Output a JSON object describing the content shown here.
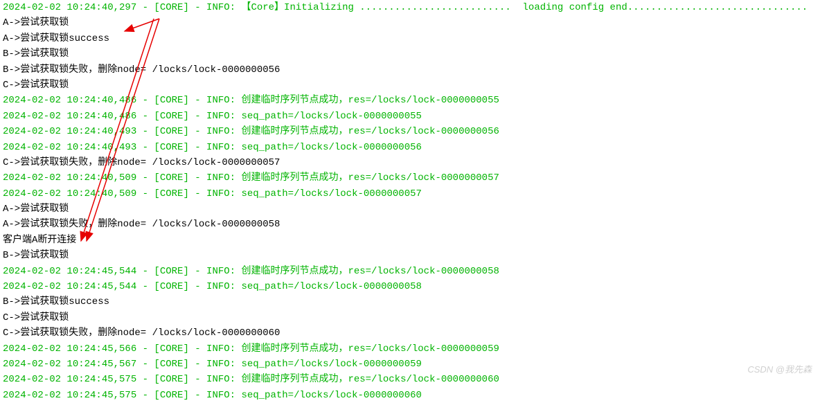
{
  "lines": [
    {
      "cls": "green",
      "text": "2024-02-02 10:24:40,297 - [CORE] - INFO: 【Core】Initializing ..........................  loading config end..............................."
    },
    {
      "cls": "black",
      "text": "A->尝试获取锁"
    },
    {
      "cls": "black",
      "text": "A->尝试获取锁success"
    },
    {
      "cls": "black",
      "text": "B->尝试获取锁"
    },
    {
      "cls": "black",
      "text": "B->尝试获取锁失败，删除node= /locks/lock-0000000056"
    },
    {
      "cls": "black",
      "text": "C->尝试获取锁"
    },
    {
      "cls": "green",
      "text": "2024-02-02 10:24:40,486 - [CORE] - INFO: 创建临时序列节点成功，res=/locks/lock-0000000055"
    },
    {
      "cls": "green",
      "text": "2024-02-02 10:24:40,486 - [CORE] - INFO: seq_path=/locks/lock-0000000055"
    },
    {
      "cls": "green",
      "text": "2024-02-02 10:24:40,493 - [CORE] - INFO: 创建临时序列节点成功，res=/locks/lock-0000000056"
    },
    {
      "cls": "green",
      "text": "2024-02-02 10:24:40,493 - [CORE] - INFO: seq_path=/locks/lock-0000000056"
    },
    {
      "cls": "black",
      "text": "C->尝试获取锁失败，删除node= /locks/lock-0000000057"
    },
    {
      "cls": "green",
      "text": "2024-02-02 10:24:40,509 - [CORE] - INFO: 创建临时序列节点成功，res=/locks/lock-0000000057"
    },
    {
      "cls": "green",
      "text": "2024-02-02 10:24:40,509 - [CORE] - INFO: seq_path=/locks/lock-0000000057"
    },
    {
      "cls": "black",
      "text": "A->尝试获取锁"
    },
    {
      "cls": "black",
      "text": "A->尝试获取锁失败，删除node= /locks/lock-0000000058"
    },
    {
      "cls": "black",
      "text": "客户端A断开连接"
    },
    {
      "cls": "black",
      "text": "B->尝试获取锁"
    },
    {
      "cls": "green",
      "text": "2024-02-02 10:24:45,544 - [CORE] - INFO: 创建临时序列节点成功，res=/locks/lock-0000000058"
    },
    {
      "cls": "green",
      "text": "2024-02-02 10:24:45,544 - [CORE] - INFO: seq_path=/locks/lock-0000000058"
    },
    {
      "cls": "black",
      "text": "B->尝试获取锁success"
    },
    {
      "cls": "black",
      "text": "C->尝试获取锁"
    },
    {
      "cls": "black",
      "text": "C->尝试获取锁失败，删除node= /locks/lock-0000000060"
    },
    {
      "cls": "green",
      "text": "2024-02-02 10:24:45,566 - [CORE] - INFO: 创建临时序列节点成功，res=/locks/lock-0000000059"
    },
    {
      "cls": "green",
      "text": "2024-02-02 10:24:45,567 - [CORE] - INFO: seq_path=/locks/lock-0000000059"
    },
    {
      "cls": "green",
      "text": "2024-02-02 10:24:45,575 - [CORE] - INFO: 创建临时序列节点成功，res=/locks/lock-0000000060"
    },
    {
      "cls": "green",
      "text": "2024-02-02 10:24:45,575 - [CORE] - INFO: seq_path=/locks/lock-0000000060"
    }
  ],
  "watermark": "CSDN @我先森"
}
